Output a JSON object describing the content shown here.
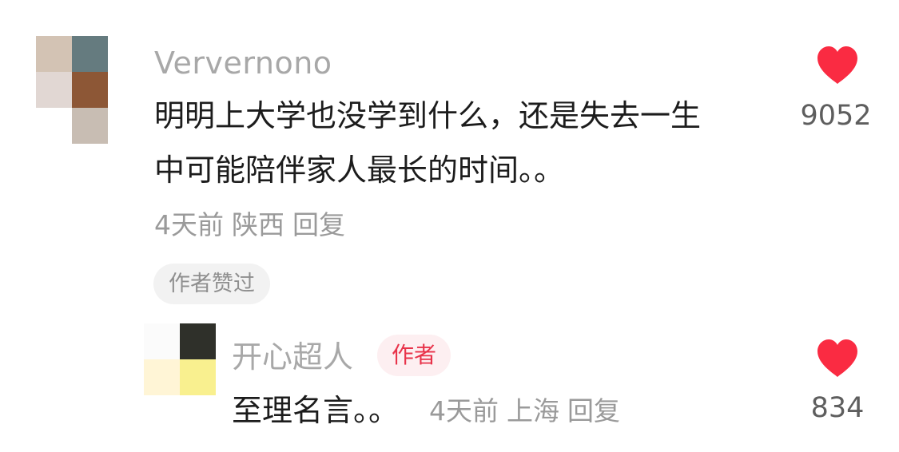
{
  "comment": {
    "username": "Ververnono",
    "avatar_pixels": [
      "#d3c3b4",
      "#657b7f",
      "#e1d7d3",
      "#8d5736",
      "#ffffff",
      "#c8bdb3"
    ],
    "text_line1": "明明上大学也没学到什么，还是失去一生",
    "text_line2": "中可能陪伴家人最长的时间。。",
    "time": "4天前",
    "location": "陕西",
    "reply_label": "回复",
    "liked_by_author_label": "作者赞过",
    "likes": "9052",
    "liked": true,
    "like_icon": "heart-icon",
    "like_color": "#fa2b42"
  },
  "reply": {
    "username": "开心超人",
    "author_badge": "作者",
    "avatar_pixels": [
      "#fbfbfb",
      "#2f302a",
      "#fff5d6",
      "#f9f08f"
    ],
    "text": "至理名言。。",
    "time": "4天前",
    "location": "上海",
    "reply_label": "回复",
    "likes": "834",
    "liked": true,
    "like_icon": "heart-icon",
    "like_color": "#fa2b42"
  }
}
